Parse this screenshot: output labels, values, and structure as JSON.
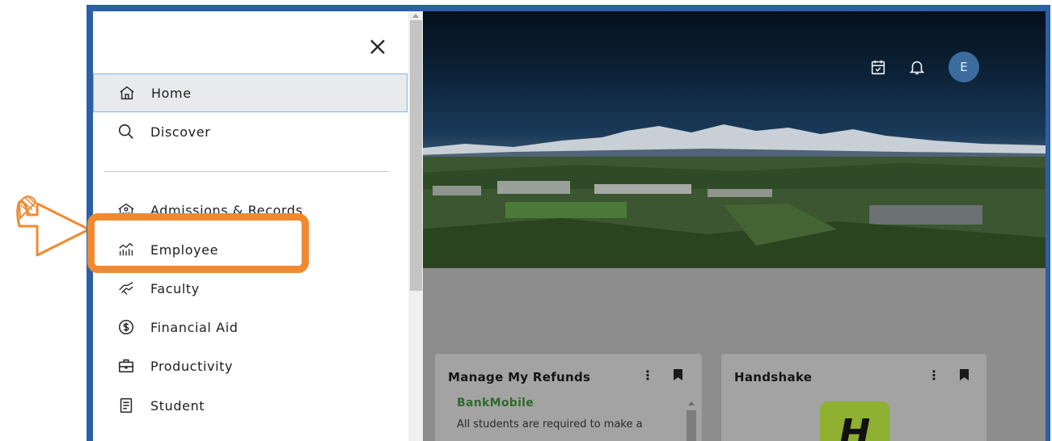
{
  "header": {
    "icons": [
      "calendar-check-icon",
      "bell-icon"
    ],
    "avatar_initial": "E"
  },
  "drawer": {
    "close_icon": "close-icon",
    "primary_items": [
      {
        "label": "Home",
        "icon": "home-icon",
        "active": true
      },
      {
        "label": "Discover",
        "icon": "search-icon",
        "active": false
      }
    ],
    "category_items": [
      {
        "label": "Admissions & Records",
        "icon": "admissions-icon"
      },
      {
        "label": "Employee",
        "icon": "employee-chart-icon"
      },
      {
        "label": "Faculty",
        "icon": "handshake-icon"
      },
      {
        "label": "Financial Aid",
        "icon": "dollar-circle-icon"
      },
      {
        "label": "Productivity",
        "icon": "briefcase-icon"
      },
      {
        "label": "Student",
        "icon": "book-icon"
      }
    ]
  },
  "cards": [
    {
      "title": "Manage My Refunds",
      "brand": "BankMobile",
      "text": "All students are required to make a"
    },
    {
      "title": "Handshake",
      "logo_letter": "H"
    }
  ],
  "colors": {
    "frame": "#2b5fa8",
    "annotation": "#f08a32",
    "active_border": "#7eb6ea",
    "avatar": "#3c6c9e"
  }
}
